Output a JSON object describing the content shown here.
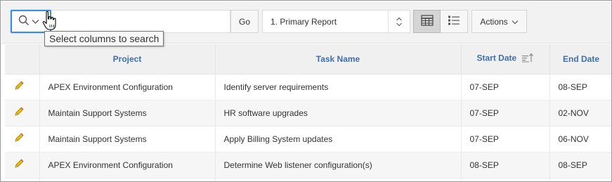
{
  "toolbar": {
    "search_placeholder": "",
    "go_label": "Go",
    "report_label": "1. Primary Report",
    "actions_label": "Actions"
  },
  "tooltip": "Select columns to search",
  "table": {
    "columns": [
      "Project",
      "Task Name",
      "Start Date",
      "End Date"
    ],
    "rows": [
      [
        "APEX Environment Configuration",
        "Identify server requirements",
        "07-SEP",
        "08-SEP"
      ],
      [
        "Maintain Support Systems",
        "HR software upgrades",
        "07-SEP",
        "02-NOV"
      ],
      [
        "Maintain Support Systems",
        "Apply Billing System updates",
        "07-SEP",
        "06-NOV"
      ],
      [
        "APEX Environment Configuration",
        "Determine Web listener configuration(s)",
        "08-SEP",
        "08-SEP"
      ]
    ],
    "sorted_column": "Start Date",
    "sort_direction": "ascending"
  },
  "icons": {
    "search": "search-icon",
    "chevron": "chevron-down-icon",
    "grid_view": "grid-view-icon",
    "list_view": "list-view-icon",
    "edit": "pencil-icon",
    "cursor": "hand-pointer-cursor"
  },
  "colors": {
    "focus_border": "#3c8dde",
    "header_text": "#3f6fa8",
    "pencil": "#e6b800"
  }
}
